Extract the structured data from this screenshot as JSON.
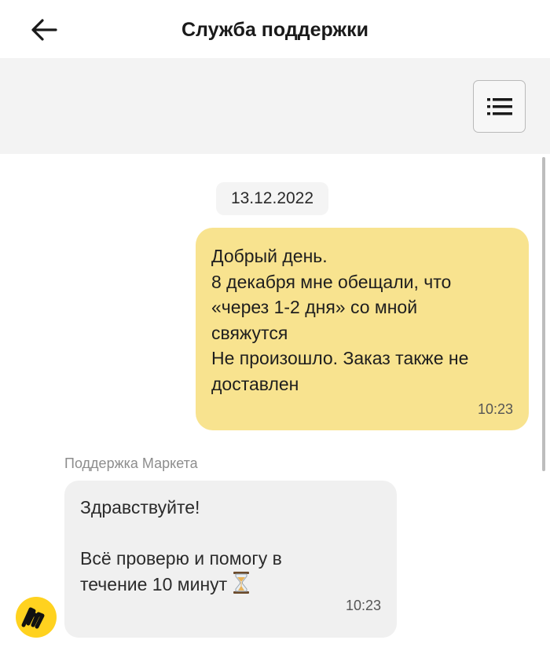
{
  "header": {
    "title": "Служба поддержки",
    "back_icon": "arrow-left-icon"
  },
  "toolbar": {
    "menu_icon": "list-menu-icon"
  },
  "chat": {
    "date": "13.12.2022",
    "messages": [
      {
        "direction": "outgoing",
        "text": "Добрый день.\n8 декабря мне обещали, что\n«через 1-2 дня» со мной\nсвяжутся\nНе произошло. Заказ также не\nдоставлен",
        "time": "10:23",
        "color": "#f8e38f"
      },
      {
        "direction": "incoming",
        "sender": "Поддержка Маркета",
        "text": "Здравствуйте!\n\nВсё проверю и помогу в\nтечение 10 минут",
        "emoji": "hourglass-icon",
        "time": "10:23",
        "color": "#f0f0f0"
      }
    ]
  },
  "colors": {
    "brand_yellow": "#ffd21f",
    "toolbar_bg": "#f3f3f3"
  }
}
